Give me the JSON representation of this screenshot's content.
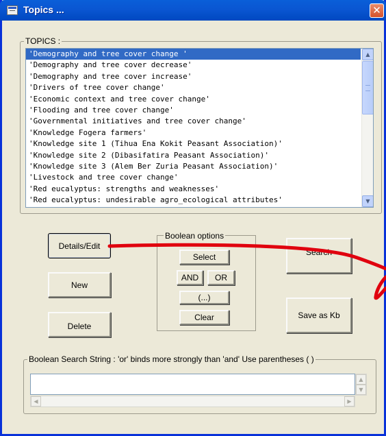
{
  "window": {
    "title": "Topics ...",
    "close_glyph": "✕"
  },
  "topics": {
    "label": "TOPICS :",
    "items": [
      "'Demography and tree cover change '",
      "'Demography and tree cover decrease'",
      "'Demography and tree cover increase'",
      "'Drivers of tree cover change'",
      "'Economic context and tree cover change'",
      "'Flooding and tree cover change'",
      "'Governmental initiatives and tree cover change'",
      "'Knowledge Fogera farmers'",
      "'Knowledge site 1 (Tihua Ena Kokit Peasant Association)'",
      "'Knowledge site 2 (Dibasifatira Peasant Association)'",
      "'Knowledge site 3 (Alem Ber Zuria Peasant Association)'",
      "'Livestock and tree cover change'",
      "'Red eucalyptus: strengths and weaknesses'",
      "'Red eucalyptus: undesirable agro_ecological attributes'"
    ],
    "selected_index": 0,
    "scroll_up_glyph": "▲",
    "scroll_down_glyph": "▼"
  },
  "buttons": {
    "details_edit": "Details/Edit",
    "new": "New",
    "delete": "Delete",
    "search": "Search",
    "save_as_kb": "Save as Kb"
  },
  "boolean_options": {
    "label": "Boolean options",
    "select": "Select",
    "and": "AND",
    "or": "OR",
    "parens": "(...)",
    "clear": "Clear"
  },
  "search_string": {
    "label": "Boolean Search String :  'or' binds more strongly than 'and'    Use parentheses ( )",
    "value": "",
    "left_glyph": "◀",
    "right_glyph": "▶",
    "up_glyph": "▲",
    "down_glyph": "▼"
  },
  "icons": {
    "window": "window-app-icon",
    "close": "close-icon",
    "annotation": "red-annotation-arrow"
  },
  "colors": {
    "titlebar": "#0a56d2",
    "selection": "#316ac5",
    "annotation": "#e0000e"
  }
}
